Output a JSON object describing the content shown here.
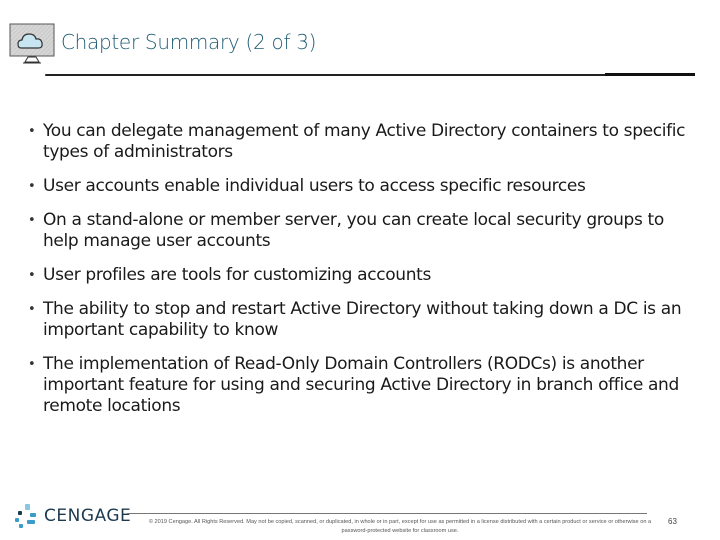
{
  "header": {
    "icon": "cloud-monitor-icon",
    "title": "Chapter Summary (2 of 3)"
  },
  "bullets": [
    "You can delegate management of many Active Directory containers to specific types of administrators",
    "User accounts enable individual users to access specific resources",
    "On a stand-alone or member server, you can create local security groups to help manage user accounts",
    "User profiles are tools for customizing accounts",
    "The ability to stop and restart Active Directory without taking down a DC is an important capability to know",
    "The implementation of Read-Only Domain Controllers (RODCs) is another important feature for using and securing Active Directory in branch office and remote locations"
  ],
  "footer": {
    "logo_text": "CENGAGE",
    "copyright": "© 2019 Cengage. All Rights Reserved. May not be copied, scanned, or duplicated, in whole or in part, except for use as permitted in a license distributed with a certain product or service or otherwise on a password-protected website for classroom use.",
    "page_number": "63"
  },
  "colors": {
    "title": "#1f5c73",
    "logo_accent": "#3a9cc8",
    "logo_text": "#1d3a4f"
  }
}
